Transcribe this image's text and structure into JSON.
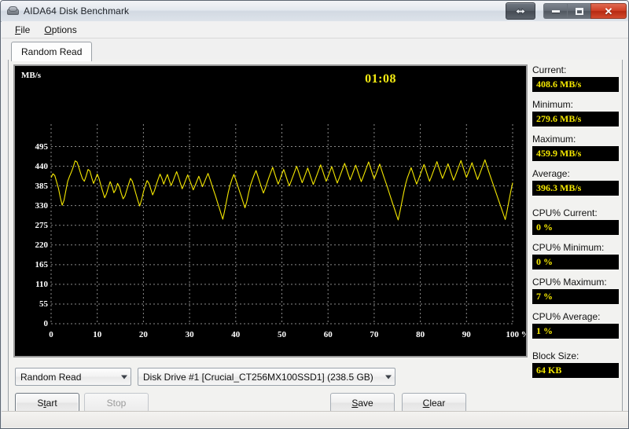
{
  "window": {
    "title": "AIDA64 Disk Benchmark",
    "icon": "disk-drive-icon",
    "buttons": {
      "resize": "resize-arrows",
      "minimize": "minimize",
      "maximize": "maximize",
      "close": "✕"
    }
  },
  "menu": {
    "items": [
      {
        "label": "File",
        "accel": "F"
      },
      {
        "label": "Options",
        "accel": "O"
      }
    ]
  },
  "tabs": [
    {
      "label": "Random Read",
      "active": true
    }
  ],
  "graph": {
    "timer": "01:08",
    "yaxis_unit": "MB/s",
    "accent_color": "#f5e800",
    "background_color": "#000000",
    "grid_color": "#8a8a8a"
  },
  "stats": [
    {
      "label": "Current:",
      "value": "408.6 MB/s"
    },
    {
      "label": "Minimum:",
      "value": "279.6 MB/s"
    },
    {
      "label": "Maximum:",
      "value": "459.9 MB/s"
    },
    {
      "label": "Average:",
      "value": "396.3 MB/s"
    },
    {
      "label": "CPU% Current:",
      "value": "0 %"
    },
    {
      "label": "CPU% Minimum:",
      "value": "0 %"
    },
    {
      "label": "CPU% Maximum:",
      "value": "7 %"
    },
    {
      "label": "CPU% Average:",
      "value": "1 %"
    },
    {
      "label": "Block Size:",
      "value": "64 KB"
    }
  ],
  "controls": {
    "test_mode": "Random Read",
    "drive": "Disk Drive #1  [Crucial_CT256MX100SSD1]  (238.5 GB)",
    "start_label": "Start",
    "start_accel": "t",
    "stop_label": "Stop",
    "stop_disabled": true,
    "save_label": "Save",
    "save_accel": "S",
    "clear_label": "Clear",
    "clear_accel": "C"
  },
  "chart_data": {
    "type": "line",
    "title": "Random Read",
    "xlabel": "",
    "ylabel": "MB/s",
    "xlim": [
      0,
      100
    ],
    "ylim": [
      0,
      522.5
    ],
    "grid": true,
    "legend": null,
    "x_ticks": [
      "0",
      "10",
      "20",
      "30",
      "40",
      "50",
      "60",
      "70",
      "80",
      "90",
      "100 %"
    ],
    "x_tick_values": [
      0,
      10,
      20,
      30,
      40,
      50,
      60,
      70,
      80,
      90,
      100
    ],
    "y_ticks": [
      "0",
      "55",
      "110",
      "165",
      "220",
      "275",
      "330",
      "385",
      "440",
      "495"
    ],
    "y_tick_values": [
      0,
      55,
      110,
      165,
      220,
      275,
      330,
      385,
      440,
      495
    ],
    "series": [
      {
        "name": "Random Read",
        "color": "#f5e800",
        "units": "MB/s",
        "x": [
          0.0,
          0.4,
          0.8,
          1.2,
          1.6,
          2.0,
          2.4,
          2.8,
          3.2,
          3.6,
          4.0,
          4.4,
          4.8,
          5.2,
          5.6,
          6.0,
          6.4,
          6.8,
          7.2,
          7.6,
          8.0,
          8.4,
          8.8,
          9.2,
          9.6,
          10.0,
          10.4,
          10.8,
          11.2,
          11.6,
          12.0,
          12.4,
          12.8,
          13.2,
          13.6,
          14.0,
          14.4,
          14.8,
          15.2,
          15.6,
          16.0,
          16.4,
          16.8,
          17.2,
          17.6,
          18.0,
          18.4,
          18.8,
          19.2,
          19.6,
          20.0,
          20.4,
          20.8,
          21.2,
          21.6,
          22.0,
          22.4,
          22.8,
          23.2,
          23.6,
          24.0,
          24.4,
          24.8,
          25.2,
          25.6,
          26.0,
          26.4,
          26.8,
          27.2,
          27.6,
          28.0,
          28.4,
          28.8,
          29.2,
          29.6,
          30.0,
          30.4,
          30.8,
          31.2,
          31.6,
          32.0,
          32.4,
          32.8,
          33.2,
          33.6,
          34.0,
          34.4,
          34.8,
          35.2,
          35.6,
          36.0,
          36.4,
          36.8,
          37.2,
          37.6,
          38.0,
          38.4,
          38.8,
          39.2,
          39.6,
          40.0,
          40.4,
          40.8,
          41.2,
          41.6,
          42.0,
          42.4,
          42.8,
          43.2,
          43.6,
          44.0,
          44.4,
          44.8,
          45.2,
          45.6,
          46.0,
          46.4,
          46.8,
          47.2,
          47.6,
          48.0,
          48.4,
          48.8,
          49.2,
          49.6,
          50.0,
          50.4,
          50.8,
          51.2,
          51.6,
          52.0,
          52.4,
          52.8,
          53.2,
          53.6,
          54.0,
          54.4,
          54.8,
          55.2,
          55.6,
          56.0,
          56.4,
          56.8,
          57.2,
          57.6,
          58.0,
          58.4,
          58.8,
          59.2,
          59.6,
          60.0,
          60.4,
          60.8,
          61.2,
          61.6,
          62.0,
          62.4,
          62.8,
          63.2,
          63.6,
          64.0,
          64.4,
          64.8,
          65.2,
          65.6,
          66.0,
          66.4,
          66.8,
          67.2,
          67.6,
          68.0,
          68.4,
          68.8,
          69.2,
          69.6,
          70.0,
          70.4,
          70.8,
          71.2,
          71.6,
          72.0,
          72.4,
          72.8,
          73.2,
          73.6,
          74.0,
          74.4,
          74.8,
          75.2,
          75.6,
          76.0,
          76.4,
          76.8,
          77.2,
          77.6,
          78.0,
          78.4,
          78.8,
          79.2,
          79.6,
          80.0,
          80.4,
          80.8,
          81.2,
          81.6,
          82.0,
          82.4,
          82.8,
          83.2,
          83.6,
          84.0,
          84.4,
          84.8,
          85.2,
          85.6,
          86.0,
          86.4,
          86.8,
          87.2,
          87.6,
          88.0,
          88.4,
          88.8,
          89.2,
          89.6,
          90.0,
          90.4,
          90.8,
          91.2,
          91.6,
          92.0,
          92.4,
          92.8,
          93.2,
          93.6,
          94.0,
          94.4,
          94.8,
          95.2,
          95.6,
          96.0,
          96.4,
          96.8,
          97.2,
          97.6,
          98.0,
          98.4,
          98.8,
          99.2,
          99.6,
          100.0
        ],
        "y": [
          408,
          419,
          414,
          396,
          378,
          352,
          331,
          345,
          372,
          398,
          412,
          424,
          438,
          455,
          452,
          437,
          420,
          405,
          398,
          413,
          431,
          427,
          408,
          392,
          404,
          418,
          405,
          386,
          369,
          352,
          363,
          381,
          397,
          384,
          366,
          375,
          392,
          383,
          364,
          349,
          357,
          374,
          390,
          406,
          398,
          380,
          362,
          344,
          329,
          346,
          368,
          386,
          400,
          392,
          376,
          360,
          372,
          389,
          404,
          418,
          406,
          390,
          404,
          417,
          401,
          386,
          398,
          412,
          425,
          410,
          393,
          377,
          389,
          403,
          416,
          402,
          388,
          374,
          386,
          399,
          412,
          398,
          383,
          395,
          408,
          420,
          405,
          389,
          373,
          358,
          341,
          325,
          308,
          292,
          316,
          342,
          368,
          388,
          404,
          417,
          403,
          387,
          371,
          356,
          340,
          324,
          341,
          366,
          387,
          402,
          416,
          428,
          412,
          396,
          380,
          365,
          378,
          394,
          409,
          423,
          437,
          421,
          405,
          390,
          403,
          418,
          431,
          416,
          400,
          385,
          398,
          412,
          426,
          440,
          425,
          409,
          394,
          407,
          421,
          435,
          420,
          404,
          389,
          402,
          416,
          430,
          444,
          429,
          413,
          398,
          411,
          425,
          439,
          424,
          408,
          393,
          406,
          420,
          434,
          448,
          433,
          417,
          402,
          415,
          429,
          443,
          428,
          412,
          397,
          410,
          424,
          438,
          452,
          436,
          420,
          405,
          418,
          432,
          446,
          430,
          414,
          399,
          384,
          368,
          352,
          336,
          321,
          305,
          290,
          314,
          340,
          366,
          390,
          408,
          422,
          436,
          421,
          405,
          390,
          403,
          417,
          431,
          445,
          429,
          413,
          398,
          411,
          425,
          439,
          453,
          437,
          421,
          406,
          419,
          433,
          447,
          432,
          416,
          401,
          414,
          428,
          442,
          456,
          440,
          424,
          409,
          422,
          436,
          450,
          434,
          418,
          403,
          416,
          430,
          444,
          458,
          442,
          426,
          411,
          396,
          381,
          366,
          351,
          336,
          321,
          306,
          291,
          316,
          343,
          370,
          394,
          412,
          426,
          440,
          424,
          409
        ]
      }
    ],
    "summary": {
      "current": 408.6,
      "minimum": 279.6,
      "maximum": 459.9,
      "average": 396.3,
      "cpu_current": 0,
      "cpu_minimum": 0,
      "cpu_maximum": 7,
      "cpu_average": 1,
      "block_size_kb": 64,
      "elapsed": "01:08"
    }
  }
}
